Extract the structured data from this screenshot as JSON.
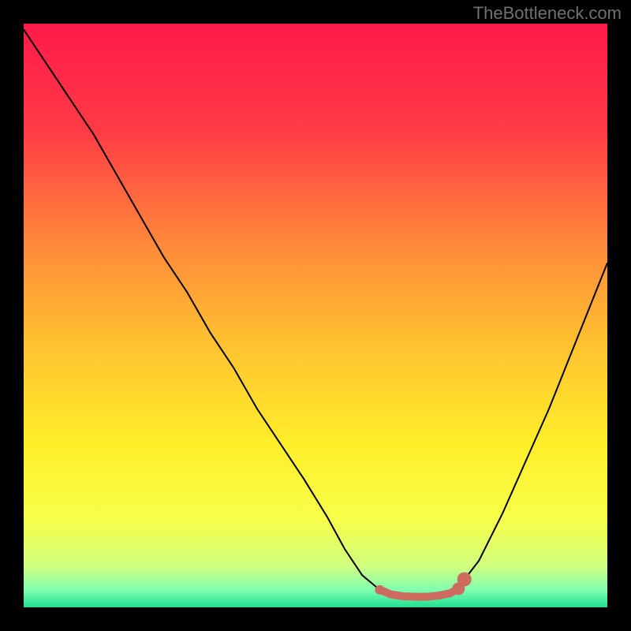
{
  "attribution": "TheBottleneck.com",
  "chart_data": {
    "type": "line",
    "title": "",
    "xlabel": "",
    "ylabel": "",
    "xlim": [
      0,
      100
    ],
    "ylim": [
      0,
      100
    ],
    "background_gradient": {
      "stops": [
        {
          "offset": 0,
          "color": "#ff1a4a"
        },
        {
          "offset": 18,
          "color": "#ff3a46"
        },
        {
          "offset": 38,
          "color": "#ff8a3a"
        },
        {
          "offset": 55,
          "color": "#ffc230"
        },
        {
          "offset": 72,
          "color": "#ffee2a"
        },
        {
          "offset": 85,
          "color": "#f7ff4a"
        },
        {
          "offset": 93,
          "color": "#d0ff80"
        },
        {
          "offset": 97,
          "color": "#80ffb0"
        },
        {
          "offset": 100,
          "color": "#20e090"
        }
      ]
    },
    "series": [
      {
        "name": "bottleneck-curve",
        "color": "#000000",
        "x": [
          0,
          4,
          8,
          12,
          16,
          20,
          24,
          28,
          32,
          36,
          40,
          44,
          48,
          52,
          55,
          58,
          61,
          64,
          70,
          74,
          78,
          82,
          86,
          90,
          94,
          98,
          100
        ],
        "values": [
          99,
          93,
          87,
          81,
          74,
          67,
          60,
          54,
          47,
          41,
          34,
          28,
          22,
          15.5,
          10,
          5.5,
          3,
          1.8,
          1.8,
          2.8,
          8,
          16,
          25,
          34,
          44,
          54,
          59
        ]
      },
      {
        "name": "optimal-marker",
        "color": "#cc6b5e",
        "type": "marker-line",
        "points": [
          {
            "x": 61,
            "y": 3.0,
            "size": 6
          },
          {
            "x": 63,
            "y": 2.2,
            "size": 5
          },
          {
            "x": 65,
            "y": 1.9,
            "size": 5
          },
          {
            "x": 67,
            "y": 1.8,
            "size": 5
          },
          {
            "x": 69,
            "y": 1.8,
            "size": 5
          },
          {
            "x": 71,
            "y": 2.0,
            "size": 5
          },
          {
            "x": 73,
            "y": 2.4,
            "size": 6
          },
          {
            "x": 74.5,
            "y": 3.2,
            "size": 8
          },
          {
            "x": 75.5,
            "y": 4.8,
            "size": 9
          }
        ]
      }
    ]
  }
}
